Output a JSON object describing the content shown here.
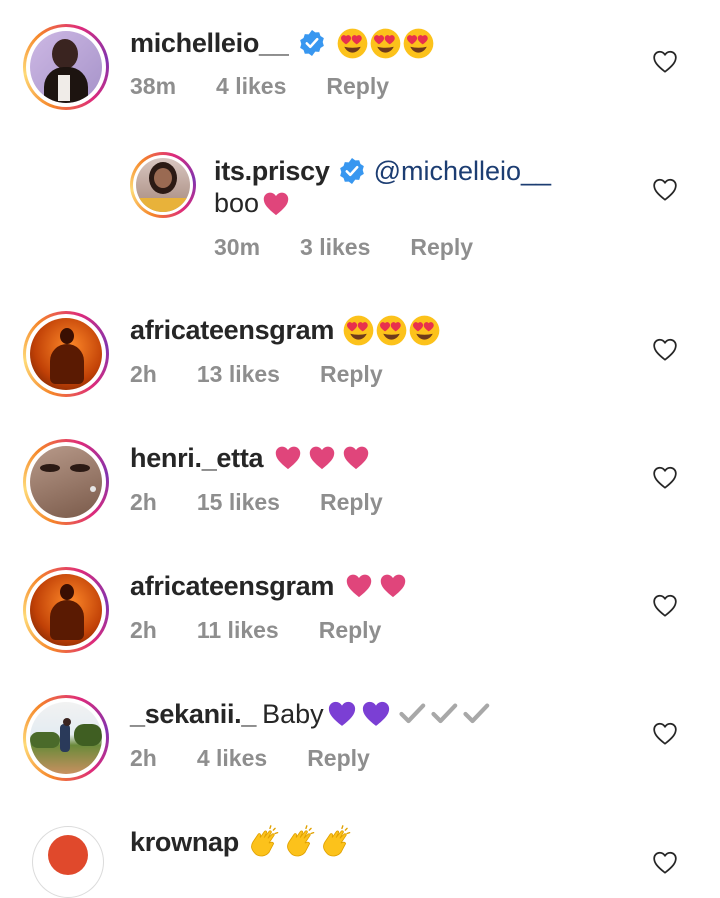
{
  "comments": [
    {
      "username": "michelleio__",
      "verified": true,
      "text": "",
      "emojis": "😍😍😍",
      "time": "38m",
      "likes": "4 likes",
      "reply": "Reply"
    },
    {
      "username": "its.priscy",
      "verified": true,
      "mention": "@michelleio__",
      "text": "boo",
      "emojis": "❤",
      "time": "30m",
      "likes": "3 likes",
      "reply": "Reply"
    },
    {
      "username": "africateensgram",
      "text": "",
      "emojis": "😍😍😍",
      "time": "2h",
      "likes": "13 likes",
      "reply": "Reply"
    },
    {
      "username": "henri._etta",
      "text": "",
      "emojis": "❤❤❤",
      "time": "2h",
      "likes": "15 likes",
      "reply": "Reply"
    },
    {
      "username": "africateensgram",
      "text": "",
      "emojis": "❤❤",
      "time": "2h",
      "likes": "11 likes",
      "reply": "Reply"
    },
    {
      "username": "_sekanii._",
      "text": "Baby",
      "emojis": "💜💜✔✔✔",
      "time": "2h",
      "likes": "4 likes",
      "reply": "Reply"
    },
    {
      "username": "krownap",
      "text": "",
      "emojis": "👏👏👏"
    }
  ],
  "colors": {
    "heart_pink": "#e0457b",
    "heart_purple": "#7b3fd4",
    "check_gray": "#a0a0a0",
    "verified_blue": "#3897f0",
    "meta_gray": "#8e8e8e"
  },
  "icons": {
    "like": "heart-outline-icon",
    "verified": "verified-badge-icon"
  }
}
